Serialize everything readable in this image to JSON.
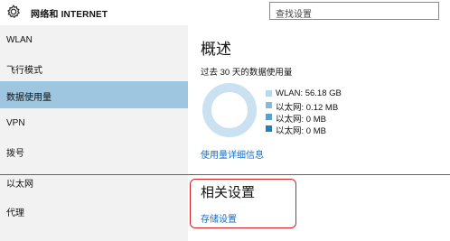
{
  "titlebar": {
    "title": "网络和 INTERNET",
    "icon": "gear-icon"
  },
  "search": {
    "placeholder": "查找设置"
  },
  "sidebar": {
    "items": [
      {
        "label": "WLAN"
      },
      {
        "label": "飞行模式"
      },
      {
        "label": "数据使用量",
        "selected": true
      },
      {
        "label": "VPN"
      },
      {
        "label": "拨号"
      },
      {
        "label": "以太网"
      },
      {
        "label": "代理"
      }
    ]
  },
  "main": {
    "title": "概述",
    "usage_note": "过去 30 天的数据使用量",
    "legend": [
      {
        "text": "WLAN: 56.18 GB",
        "color": "#b9d9ec"
      },
      {
        "text": "以太网: 0.12 MB",
        "color": "#8ab8d8"
      },
      {
        "text": "以太网: 0 MB",
        "color": "#5f9ec8"
      },
      {
        "text": "以太网: 0 MB",
        "color": "#2f7ab0"
      }
    ],
    "usage_link": "使用量详细信息",
    "related_title": "相关设置",
    "storage_link": "存储设置"
  },
  "colors": {
    "accent": "#1a6dc0",
    "selected_bg": "#9ec6e0",
    "annotation_red": "#d42020"
  }
}
